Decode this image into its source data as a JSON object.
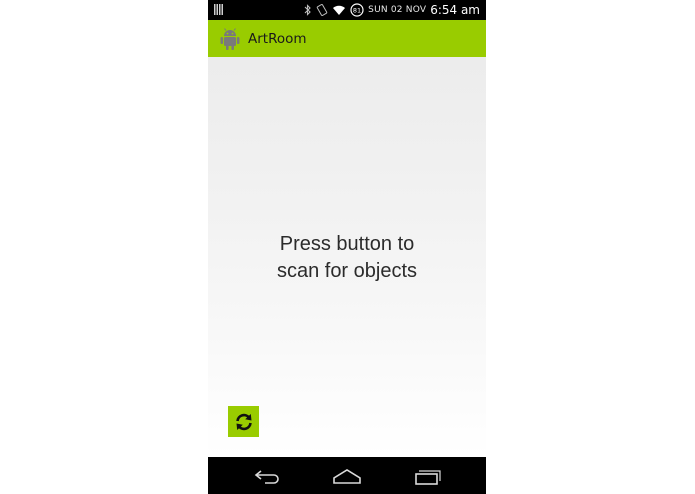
{
  "status_bar": {
    "date": "SUN 02 NOV",
    "time": "6:54 am",
    "battery_level": "81",
    "icons": [
      "signal-bars-icon",
      "bluetooth-icon",
      "rotation-icon",
      "wifi-icon",
      "battery-icon"
    ]
  },
  "action_bar": {
    "title": "ArtRoom",
    "icon": "android-robot-icon",
    "color": "#99cc00"
  },
  "main": {
    "message_line1": "Press button to",
    "message_line2": "scan for objects"
  },
  "scan_button": {
    "icon": "refresh-icon",
    "color": "#99cc00"
  },
  "nav_bar": {
    "buttons": [
      "back-icon",
      "home-icon",
      "recent-apps-icon"
    ]
  }
}
